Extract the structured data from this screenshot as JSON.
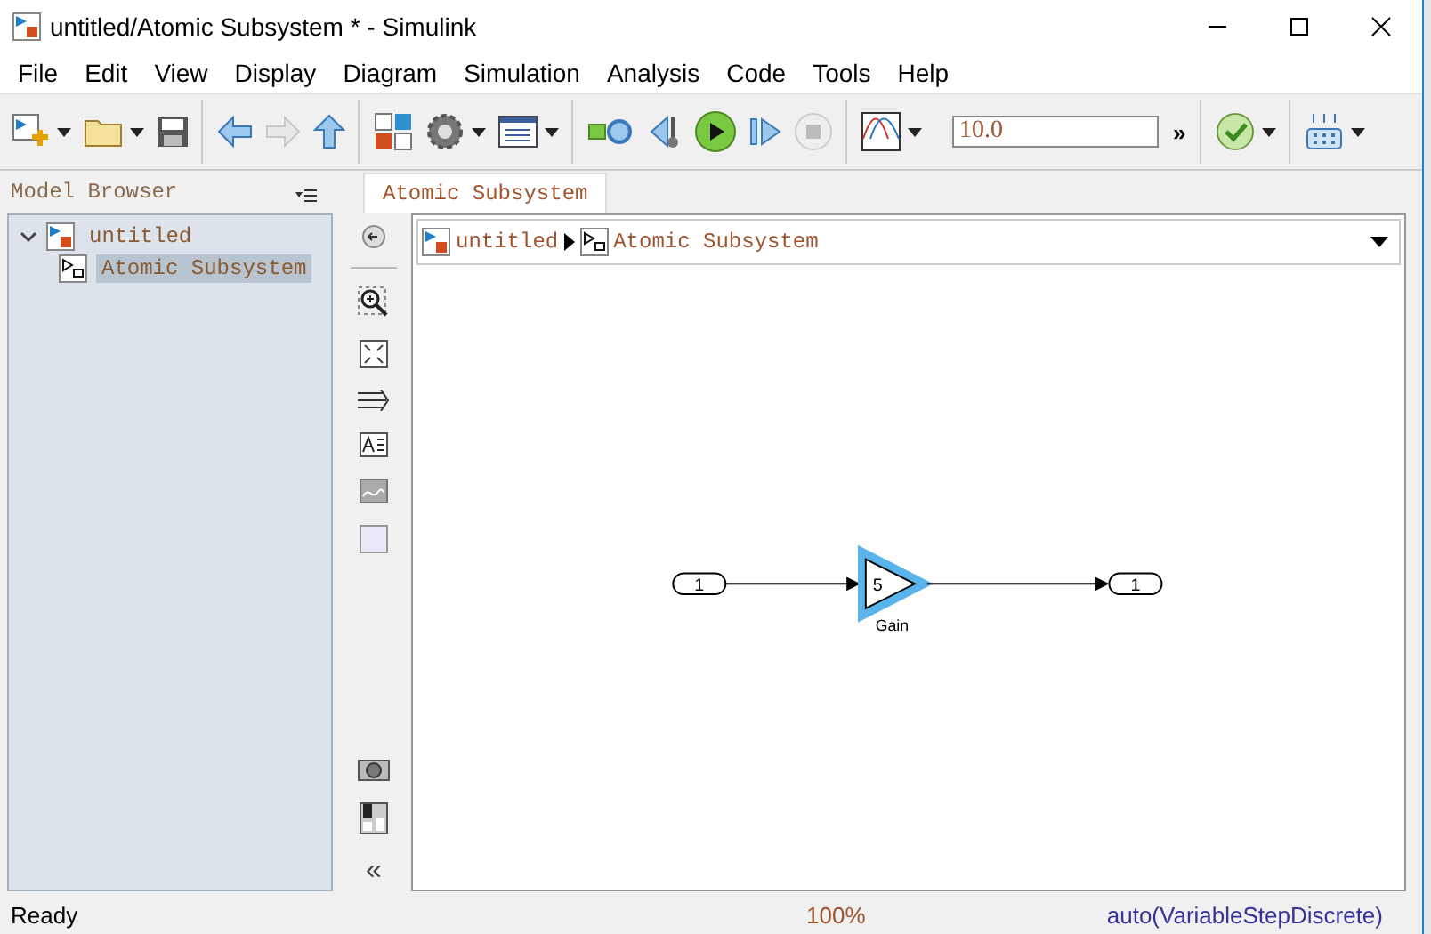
{
  "window": {
    "title": "untitled/Atomic Subsystem * - Simulink"
  },
  "menu": [
    "File",
    "Edit",
    "View",
    "Display",
    "Diagram",
    "Simulation",
    "Analysis",
    "Code",
    "Tools",
    "Help"
  ],
  "toolbar": {
    "stop_time": "10.0",
    "overflow": "»"
  },
  "model_browser": {
    "title": "Model Browser",
    "tree": [
      {
        "label": "untitled",
        "expanded": true,
        "selected": false,
        "children": [
          {
            "label": "Atomic Subsystem",
            "selected": true
          }
        ]
      }
    ]
  },
  "tabs": [
    {
      "label": "Atomic Subsystem",
      "selected": true
    }
  ],
  "breadcrumb": [
    "untitled",
    "Atomic Subsystem"
  ],
  "palette": {
    "collapse": "«"
  },
  "diagram": {
    "inport": "1",
    "gain": {
      "value": "5",
      "name": "Gain",
      "selected": true
    },
    "outport": "1"
  },
  "status_bar": {
    "state": "Ready",
    "zoom": "100%",
    "solver": "auto(VariableStepDiscrete)"
  }
}
